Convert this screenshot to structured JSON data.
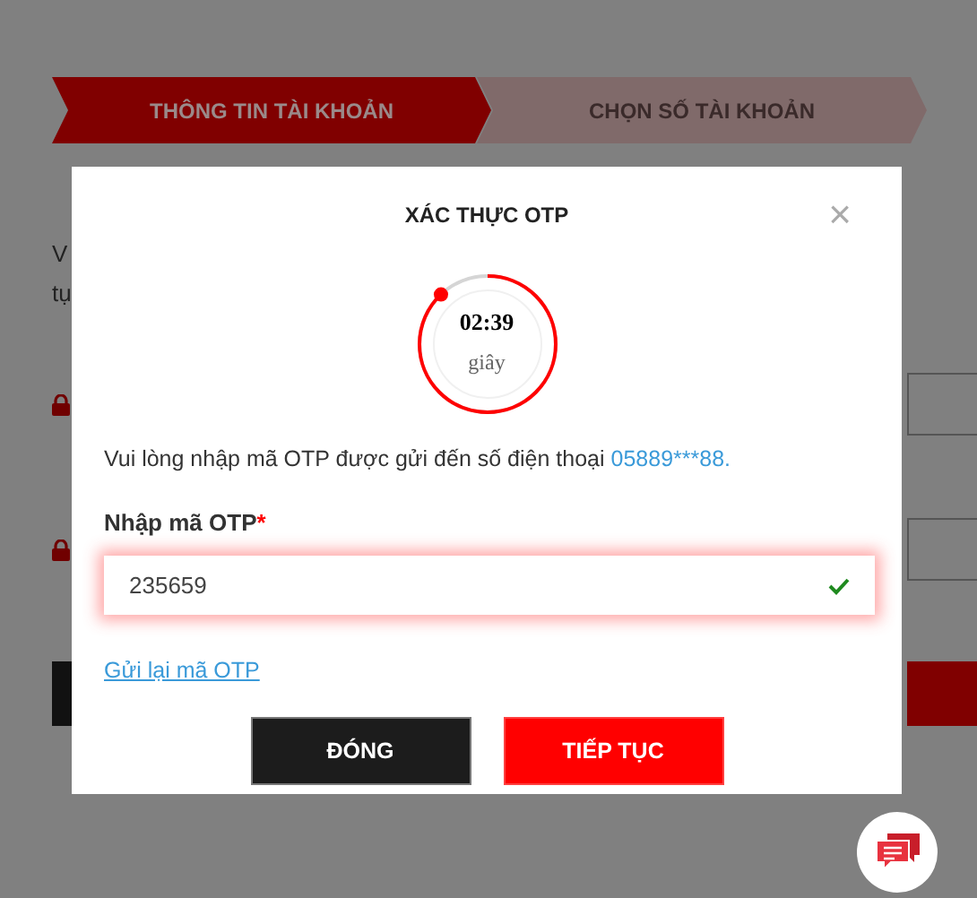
{
  "steps": [
    {
      "label": "THÔNG TIN TÀI KHOẢN",
      "selected": true
    },
    {
      "label": "CHỌN SỐ TÀI KHOẢN",
      "selected": false
    }
  ],
  "background_text": [
    "V",
    "tụ"
  ],
  "dialog": {
    "title": "XÁC THỰC OTP",
    "close": "×",
    "timer": {
      "time": "02:39",
      "unit": "giây",
      "level": 0.88
    },
    "message": "Vui lòng nhập mã OTP được gửi đến số điện thoại",
    "phone": "05889***88.",
    "otp_label": "Nhập mã OTP",
    "required_mark": "*",
    "otp_value": "235659",
    "valid": true,
    "resend_link": "Gửi lại mã OTP",
    "buttons": [
      {
        "label": "ĐÓNG",
        "kind": "secondary"
      },
      {
        "label": "TIẾP TỤC",
        "kind": "primary"
      }
    ]
  }
}
